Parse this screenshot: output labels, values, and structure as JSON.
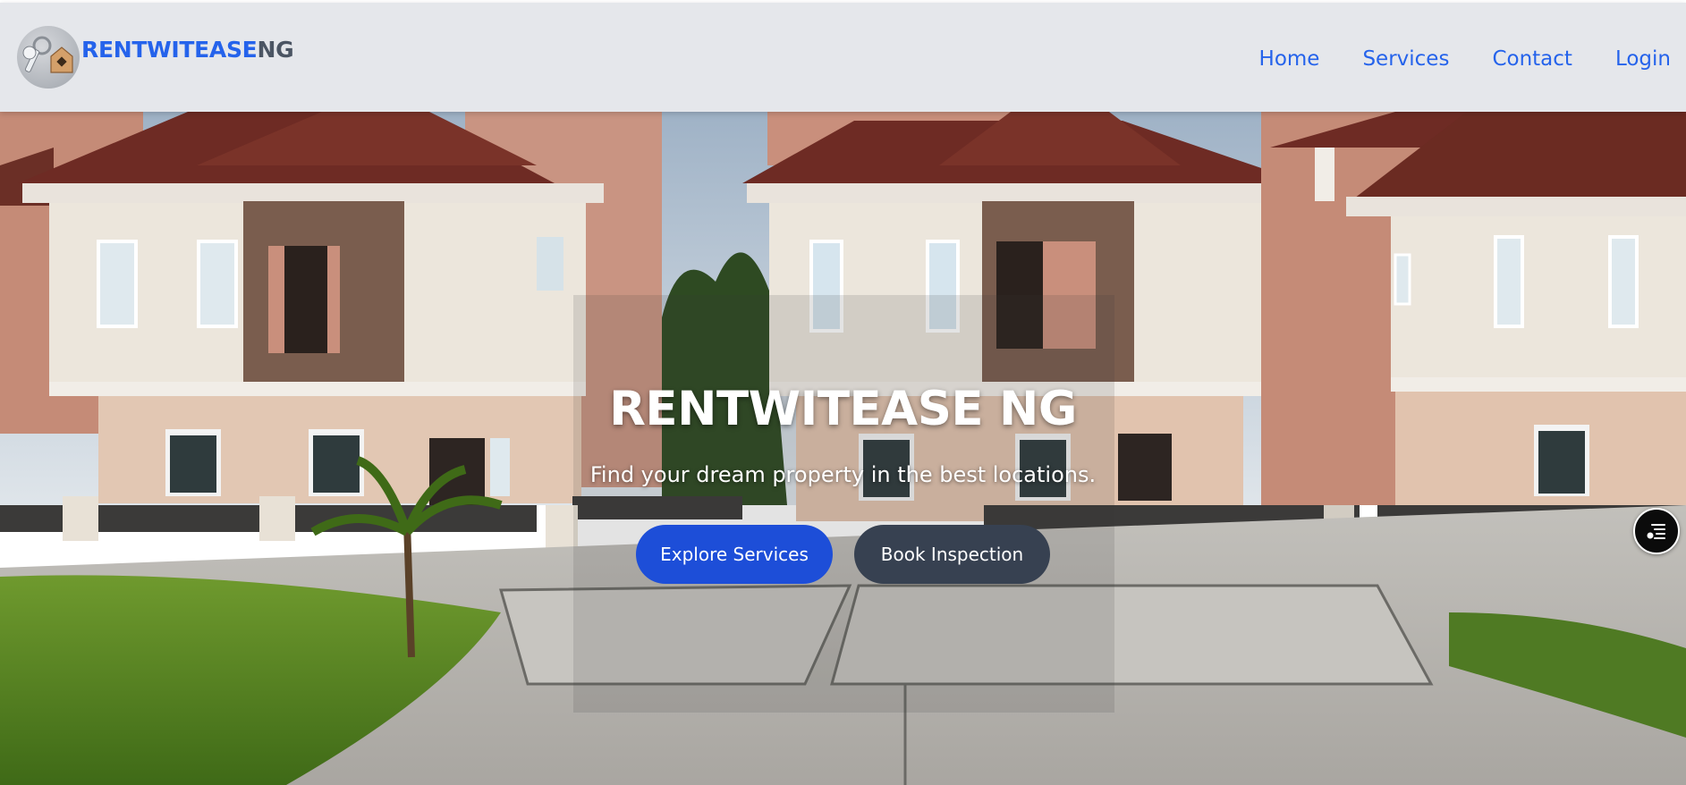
{
  "brand": {
    "name_part1": "RENTWITEASE",
    "name_part2": "NG",
    "logo_icon": "keys-house-icon"
  },
  "nav": {
    "items": [
      {
        "label": "Home"
      },
      {
        "label": "Services"
      },
      {
        "label": "Contact"
      },
      {
        "label": "Login"
      }
    ]
  },
  "hero": {
    "title": "RENTWITEASE NG",
    "subtitle": "Find your dream property in the best locations.",
    "primary_button": "Explore Services",
    "secondary_button": "Book Inspection",
    "background": "photo-of-duplex-houses"
  },
  "floating_button": {
    "icon": "filter-list-icon"
  },
  "colors": {
    "accent": "#2563eb",
    "navbar_bg": "#e5e7eb",
    "brand_secondary": "#4b5563",
    "btn_primary": "#1d4ed8",
    "btn_secondary": "#374151"
  }
}
